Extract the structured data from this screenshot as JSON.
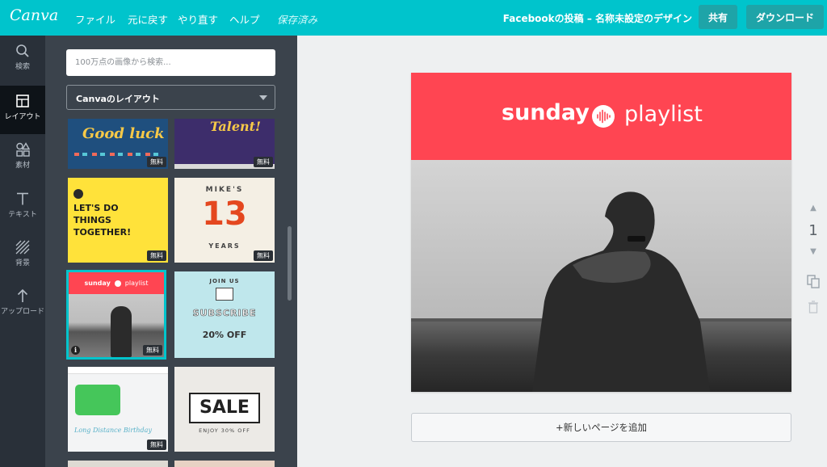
{
  "topbar": {
    "logo": "Canva",
    "menu": {
      "file": "ファイル",
      "undo": "元に戻す",
      "redo": "やり直す",
      "help": "ヘルプ",
      "saved": "保存済み"
    },
    "doc_title": "Facebookの投稿 – 名称未設定のデザイン",
    "share": "共有",
    "download": "ダウンロード"
  },
  "rail": [
    {
      "label": "検索",
      "icon": "search-icon"
    },
    {
      "label": "レイアウト",
      "icon": "layout-icon",
      "active": true
    },
    {
      "label": "素材",
      "icon": "elements-icon"
    },
    {
      "label": "テキスト",
      "icon": "text-icon"
    },
    {
      "label": "背景",
      "icon": "background-icon"
    },
    {
      "label": "アップロード",
      "icon": "upload-icon"
    }
  ],
  "panel": {
    "search_placeholder": "100万点の画像から検索...",
    "select_value": "Canvaのレイアウト",
    "free_badge": "無料",
    "thumbs": {
      "good_luck": "Good luck",
      "talent": "Talent!",
      "lets_do": "LET'S DO THINGS TOGETHER!",
      "mikes": "MIKE'S",
      "thirteen": "13",
      "years": "YEARS",
      "sunday_small": "sunday",
      "playlist_small": "playlist",
      "join_us": "JOIN US",
      "subscribe": "SUBSCRIBE",
      "off": "20% OFF",
      "long_distance": "Long Distance Birthday",
      "sale": "SALE",
      "enjoy": "ENJOY 30% OFF"
    }
  },
  "canvas": {
    "word1": "sunday",
    "word2": "playlist",
    "banner_color": "#ff4552"
  },
  "add_page": "+新しいページを追加",
  "page_number": "1",
  "colors": {
    "accent": "#00c4cc",
    "rail": "#293039",
    "panel": "#3b434c"
  }
}
